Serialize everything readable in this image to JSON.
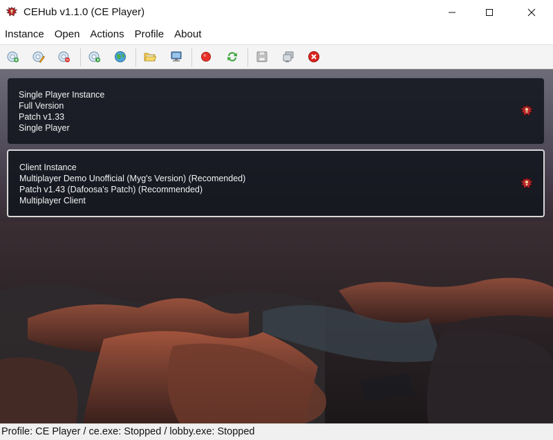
{
  "window": {
    "title": "CEHub v1.1.0 (CE Player)",
    "app_icon": "eagle-emblem-icon",
    "controls": [
      "minimize-icon",
      "maximize-icon",
      "close-icon"
    ]
  },
  "menu": [
    "Instance",
    "Open",
    "Actions",
    "Profile",
    "About"
  ],
  "toolbar": {
    "icons": [
      "add-instance-icon",
      "edit-instance-icon",
      "remove-instance-icon",
      "import-icon",
      "globe-icon",
      "open-folder-icon",
      "monitor-icon",
      "record-icon",
      "refresh-icon",
      "save-icon",
      "copy-icon",
      "stop-icon"
    ]
  },
  "instances": [
    {
      "lines": [
        "Single Player Instance",
        "Full Version",
        "Patch v1.33",
        "Single Player"
      ],
      "icon": "eagle-emblem-icon",
      "selected": false
    },
    {
      "lines": [
        "Client Instance",
        "Multiplayer Demo Unofficial (Myg's Version) (Recomended)",
        "Patch v1.43 (Dafoosa's Patch) (Recommended)",
        "Multiplayer Client"
      ],
      "icon": "eagle-emblem-icon",
      "selected": true
    }
  ],
  "status": "Profile: CE Player / ce.exe: Stopped / lobby.exe: Stopped",
  "colors": {
    "card_bg": "#12161e",
    "selected_border": "#d8d8d8",
    "emblem_red": "#b8262b"
  }
}
